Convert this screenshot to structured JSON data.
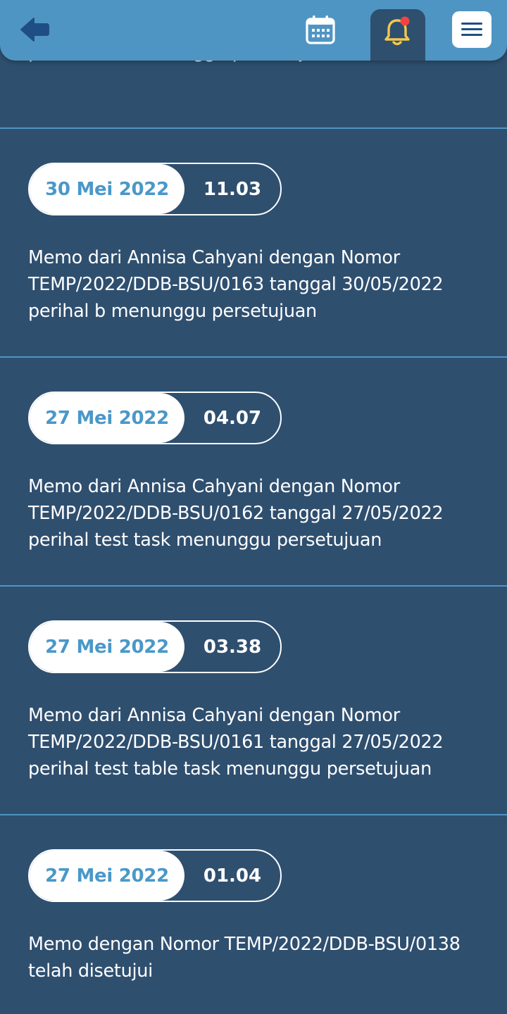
{
  "header": {
    "icons": {
      "back": "back-arrow-icon",
      "calendar": "calendar-icon",
      "bell": "bell-icon",
      "menu": "hamburger-menu-icon"
    },
    "colors": {
      "header_bg": "#4f95c4",
      "page_bg": "#2f4f6f",
      "bell_color": "#f2c94c",
      "badge_color": "#ef4444"
    }
  },
  "notifications": {
    "partial_message": "perihal abc menunggu persetujuan",
    "items": [
      {
        "date": "30 Mei 2022",
        "time": "11.03",
        "message": "Memo dari Annisa Cahyani dengan Nomor TEMP/2022/DDB-BSU/0163 tanggal 30/05/2022 perihal b menunggu persetujuan"
      },
      {
        "date": "27 Mei 2022",
        "time": "04.07",
        "message": "Memo dari Annisa Cahyani dengan Nomor TEMP/2022/DDB-BSU/0162 tanggal 27/05/2022 perihal test task menunggu persetujuan"
      },
      {
        "date": "27 Mei 2022",
        "time": "03.38",
        "message": "Memo dari Annisa Cahyani dengan Nomor TEMP/2022/DDB-BSU/0161 tanggal 27/05/2022 perihal test table task menunggu persetujuan"
      },
      {
        "date": "27 Mei 2022",
        "time": "01.04",
        "message": "Memo dengan Nomor TEMP/2022/DDB-BSU/0138 telah disetujui"
      }
    ]
  }
}
